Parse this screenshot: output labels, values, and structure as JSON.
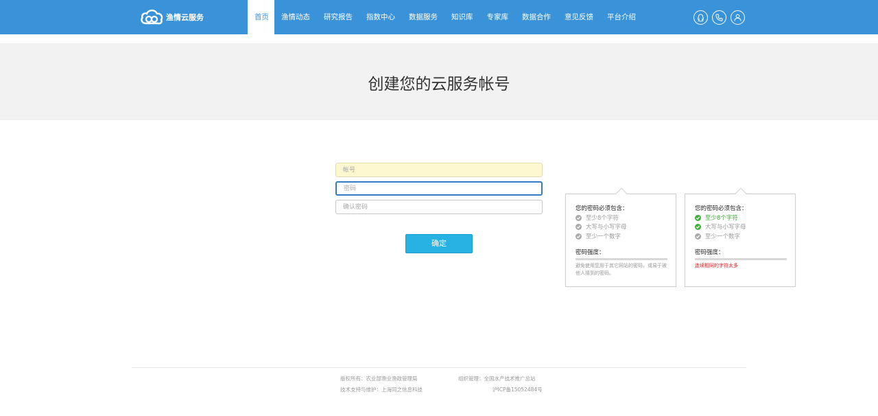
{
  "header": {
    "logo_text": "渔情云服务",
    "nav": [
      {
        "label": "首页",
        "active": true
      },
      {
        "label": "渔情动态"
      },
      {
        "label": "研究报告"
      },
      {
        "label": "指数中心"
      },
      {
        "label": "数据服务"
      },
      {
        "label": "知识库"
      },
      {
        "label": "专家库"
      },
      {
        "label": "数据合作"
      },
      {
        "label": "意见反馈"
      },
      {
        "label": "平台介绍"
      }
    ],
    "icons": [
      "qq-icon",
      "phone-icon",
      "user-icon"
    ]
  },
  "banner": {
    "title": "创建您的云服务帐号"
  },
  "form": {
    "account_placeholder": "帐号",
    "password_placeholder": "密码",
    "confirm_placeholder": "确认密码",
    "submit_label": "确定"
  },
  "tips": [
    {
      "title": "您的密码必须包含：",
      "requirements": [
        {
          "text": "至少8个字符",
          "met": false
        },
        {
          "text": "大写与小写字母",
          "met": false
        },
        {
          "text": "至少一个数字",
          "met": false
        }
      ],
      "strength_label": "密码强度：",
      "strength_note": "避免使用您用于其它网站的密码，或易于被他人猜到的密码。"
    },
    {
      "title": "您的密码必须包含：",
      "requirements": [
        {
          "text": "至少8个字符",
          "met": true
        },
        {
          "text": "大写与小写字母",
          "met": true
        },
        {
          "text": "至少一个数字",
          "met": false
        }
      ],
      "strength_label": "密码强度：",
      "strength_warning": "连续相同的字符太多"
    }
  ],
  "footer": {
    "copyright": "版权所有：农业部渔业渔政管理局",
    "support": "技术支持与维护：上海同之信息科技",
    "organizer": "组织管理：全国水产技术推广总站",
    "icp": "沪ICP备15052484号"
  },
  "colors": {
    "header_bg": "#3a93d8",
    "banner_bg": "#f2f2f2",
    "button_bg": "#27b2e3",
    "ok_green": "#44b03c",
    "warn_red": "#e02020"
  }
}
